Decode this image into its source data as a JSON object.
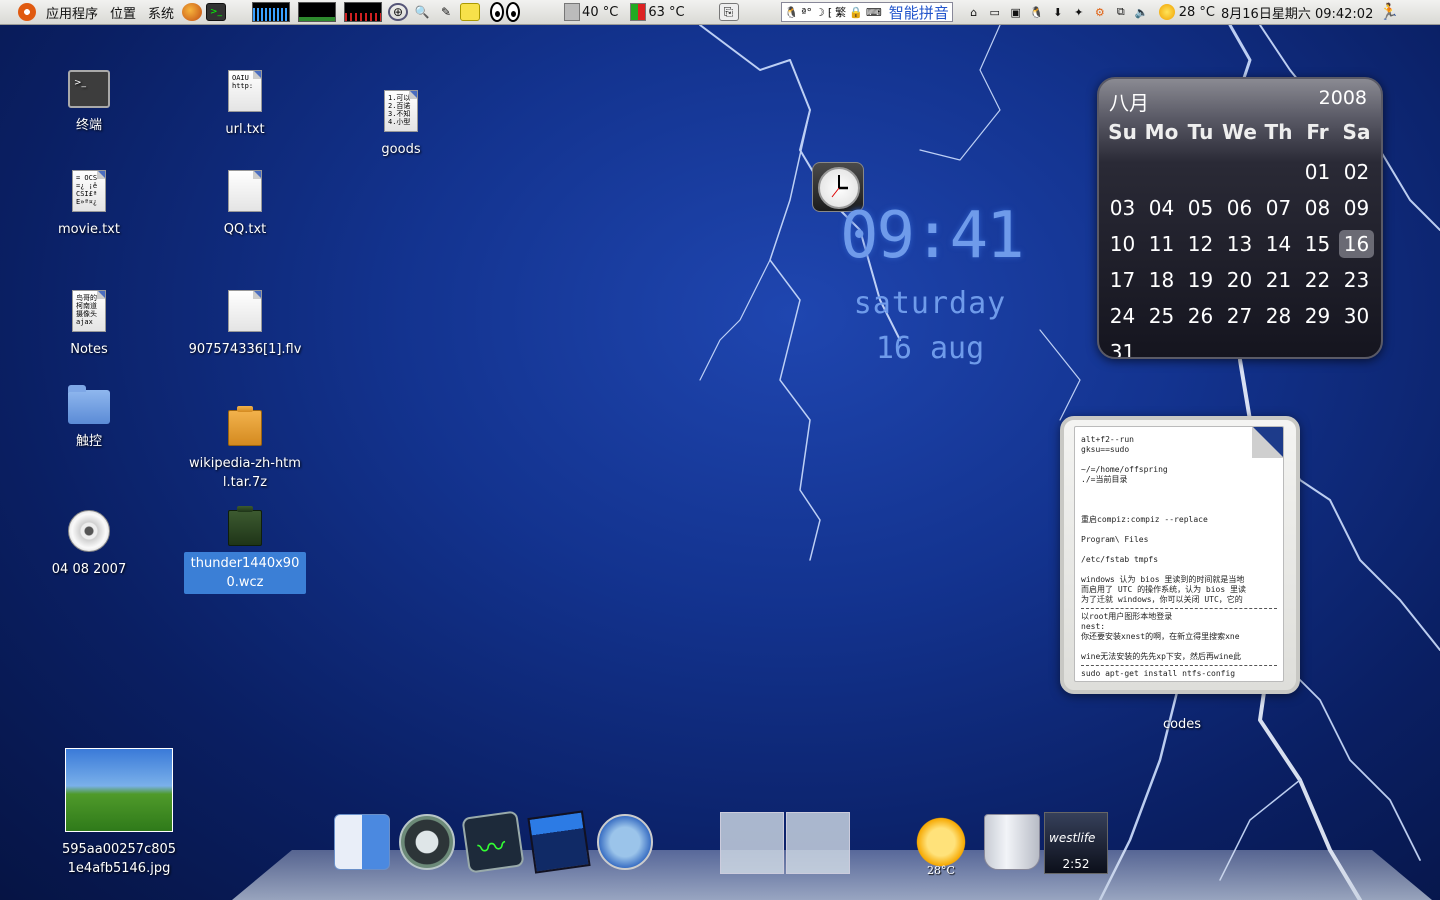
{
  "panel": {
    "menus": [
      "应用程序",
      "位置",
      "系统"
    ],
    "cpu_temp": "40 °C",
    "gpu_temp": "63 °C",
    "ime_label": "智能拼音",
    "weather": "28 °C",
    "datetime": "8月16日星期六 09:42:02"
  },
  "desktop_icons": [
    {
      "label": "终端",
      "type": "terminal"
    },
    {
      "label": "url.txt",
      "type": "text",
      "preview": "OAIU\nhttp:"
    },
    {
      "label": "goods",
      "type": "text",
      "preview": "1.可以\n2.百诺\n3.不知\n4.小型"
    },
    {
      "label": "movie.txt",
      "type": "text",
      "preview": "= OCS\n=¿ ¡ê\nCSI£ª\nE»ª¤¿"
    },
    {
      "label": "QQ.txt",
      "type": "text",
      "preview": ""
    },
    {
      "label": "Notes",
      "type": "text",
      "preview": "鸟哥的\n柯南道\n摄像头\najax"
    },
    {
      "label": "907574336[1].flv",
      "type": "text",
      "preview": ""
    },
    {
      "label": "触控",
      "type": "folder"
    },
    {
      "label": "wikipedia-zh-html.tar.7z",
      "type": "archive"
    },
    {
      "label": "04 08 2007",
      "type": "cdrom"
    },
    {
      "label": "thunder1440x900.wcz",
      "type": "archive-dark",
      "selected": true
    },
    {
      "label": "595aa00257c8051e4afb5146.jpg",
      "type": "image"
    }
  ],
  "digital_clock": {
    "time": "09:41",
    "day": "saturday",
    "date": "16 aug"
  },
  "calendar": {
    "month": "八月",
    "year": "2008",
    "weekdays": [
      "Su",
      "Mo",
      "Tu",
      "We",
      "Th",
      "Fr",
      "Sa"
    ],
    "leading_blanks": 5,
    "days": [
      "01",
      "02",
      "03",
      "04",
      "05",
      "06",
      "07",
      "08",
      "09",
      "10",
      "11",
      "12",
      "13",
      "14",
      "15",
      "16",
      "17",
      "18",
      "19",
      "20",
      "21",
      "22",
      "23",
      "24",
      "25",
      "26",
      "27",
      "28",
      "29",
      "30",
      "31"
    ],
    "today": "16"
  },
  "note": {
    "lines": [
      "alt+f2--run",
      "gksu==sudo",
      "",
      "~/=/home/offspring",
      "./=当前目录",
      "",
      "",
      "",
      "重启compiz:compiz --replace",
      "",
      "Program\\ Files",
      "",
      "/etc/fstab    tmpfs",
      "",
      "windows 认为 bios 里读到的时间就是当地",
      "而启用了 UTC 的操作系统，认为 bios 里读",
      "为了迁就 windows，你可以关闭 UTC，它的",
      "---",
      "以root用户图形本地登录",
      "nest:",
      "你还要安装xnest的啊，在新立得里搜索xne",
      "",
      "wine无法安装的先先xp下安，然后再wine此",
      "---",
      "sudo apt-get install ntfs-config"
    ],
    "label": "codes"
  },
  "dock": {
    "weather_temp": "28°C",
    "album_band": "westlife",
    "album_time": "2:52"
  },
  "colors": {
    "desktop_blue": "#13338f",
    "clock_blue": "#6f9bea",
    "selection": "#3b7fd6"
  }
}
